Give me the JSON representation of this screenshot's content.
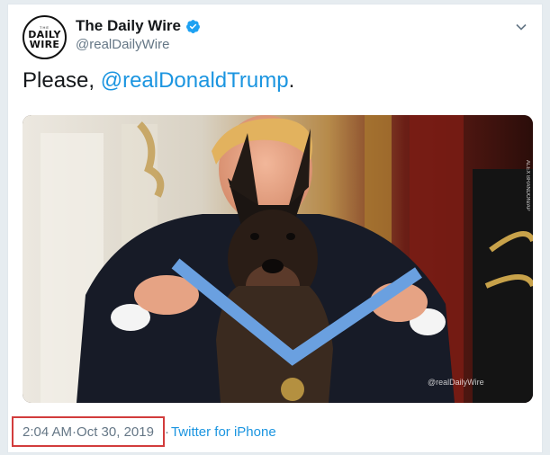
{
  "account": {
    "display_name": "The Daily Wire",
    "handle": "@realDailyWire",
    "avatar_small": "THE",
    "avatar_line1": "DAILY",
    "avatar_line2": "WIRE",
    "verified": true
  },
  "tweet": {
    "text_prefix": "Please, ",
    "mention": "@realDonaldTrump",
    "text_suffix": "."
  },
  "media": {
    "watermark": "@realDailyWire",
    "side_credit": "ALEX BRANDON/AP"
  },
  "meta": {
    "time": "2:04 AM",
    "separator1": " · ",
    "date": "Oct 30, 2019",
    "separator2": " · ",
    "source": "Twitter for iPhone"
  },
  "colors": {
    "link": "#1b95e0",
    "verified": "#1da1f2",
    "highlight_box": "#d23c3c",
    "muted_text": "#657786"
  },
  "icons": {
    "verified": "verified-badge-icon",
    "menu": "chevron-down-icon"
  }
}
